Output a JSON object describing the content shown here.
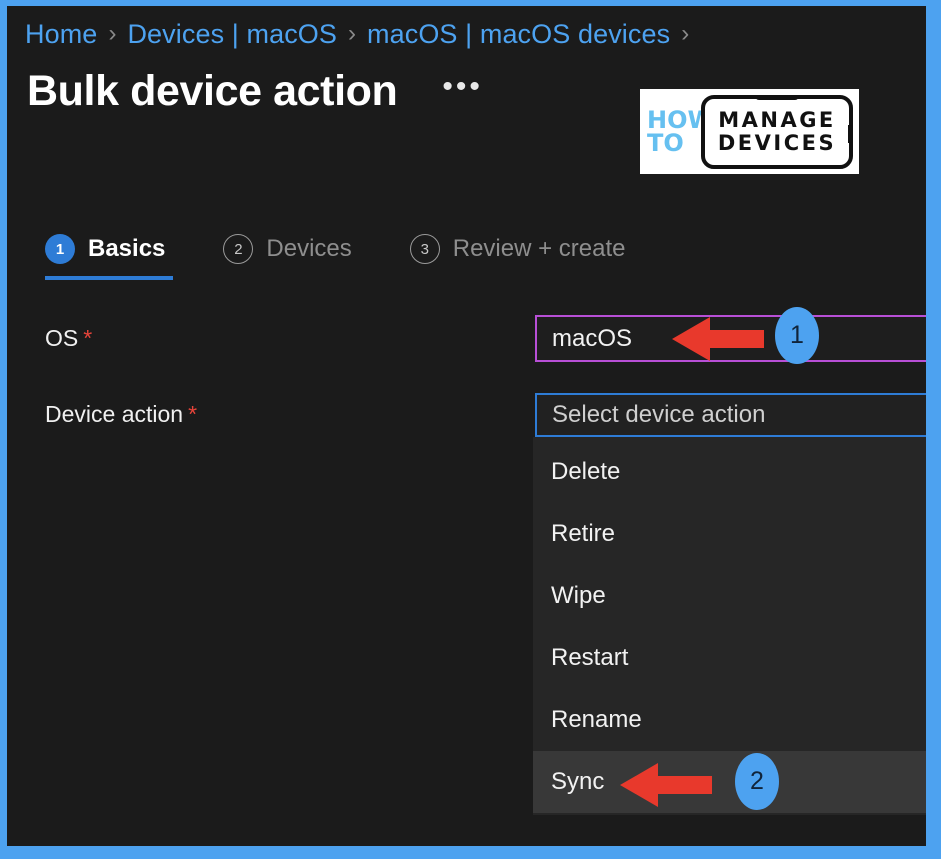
{
  "theme": {
    "frame_color": "#4da2f0",
    "page_background": "#1b1b1b",
    "accent_blue": "#2e7cd6",
    "link_blue": "#4da2f0",
    "highlight_border": "#b84fd6",
    "required_red": "#e8443a",
    "arrow_red": "#e8392c",
    "badge_blue": "#4da2f0"
  },
  "breadcrumb": {
    "items": [
      "Home",
      "Devices | macOS",
      "macOS | macOS devices"
    ],
    "separator": "›",
    "trailing_separator": "›"
  },
  "header": {
    "title": "Bulk device action",
    "more_actions": "•••"
  },
  "logo": {
    "line1": "HOW",
    "line2": "TO",
    "word1": "MANAGE",
    "word2": "DEVICES"
  },
  "wizard": {
    "tabs": [
      {
        "number": "1",
        "label": "Basics",
        "state": "active"
      },
      {
        "number": "2",
        "label": "Devices",
        "state": "inactive"
      },
      {
        "number": "3",
        "label": "Review + create",
        "state": "inactive"
      }
    ]
  },
  "form": {
    "os": {
      "label": "OS",
      "required_marker": "*",
      "value": "macOS"
    },
    "device_action": {
      "label": "Device action",
      "required_marker": "*",
      "placeholder": "Select device action",
      "value": "",
      "options": [
        {
          "label": "Delete",
          "highlighted": false
        },
        {
          "label": "Retire",
          "highlighted": false
        },
        {
          "label": "Wipe",
          "highlighted": false
        },
        {
          "label": "Restart",
          "highlighted": false
        },
        {
          "label": "Rename",
          "highlighted": false
        },
        {
          "label": "Sync",
          "highlighted": true
        }
      ]
    }
  },
  "annotations": {
    "callouts": [
      {
        "number": "1",
        "target": "os-field"
      },
      {
        "number": "2",
        "target": "dropdown-item-sync"
      }
    ]
  }
}
